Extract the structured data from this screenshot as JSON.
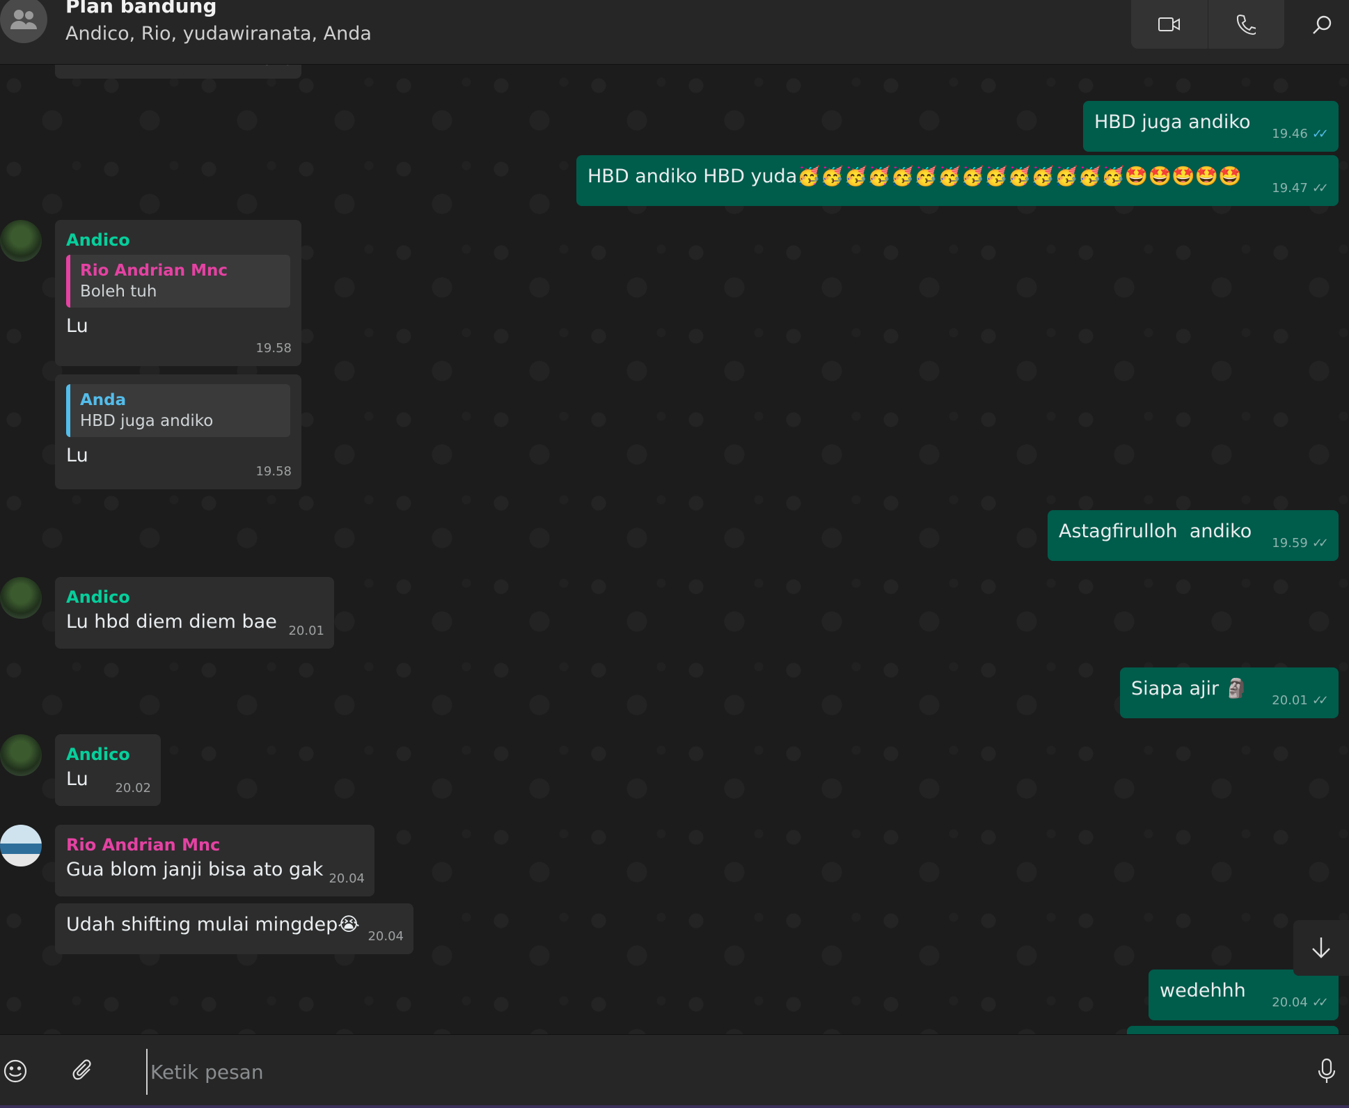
{
  "header": {
    "title": "Plan bandung",
    "members": "Andico, Rio, yudawiranata, Anda"
  },
  "messages": {
    "m0": {
      "time": "19.46"
    },
    "m1": {
      "text": "HBD juga andiko",
      "time": "19.46"
    },
    "m2": {
      "text": "HBD andiko HBD yuda🥳🥳🥳🥳🥳🥳🥳🥳🥳🥳🥳🥳🥳🥳🤩🤩🤩🤩🤩",
      "time": "19.47"
    },
    "m3": {
      "sender": "Andico",
      "quote_sender": "Rio Andrian Mnc",
      "quote_text": "Boleh tuh",
      "text": "Lu",
      "time": "19.58"
    },
    "m4": {
      "quote_sender": "Anda",
      "quote_text": "HBD juga andiko",
      "text": "Lu",
      "time": "19.58"
    },
    "m5": {
      "text": "Astagfirulloh  andiko",
      "time": "19.59"
    },
    "m6": {
      "sender": "Andico",
      "text": "Lu hbd diem diem bae",
      "time": "20.01"
    },
    "m7": {
      "text": "Siapa ajir 🗿",
      "time": "20.01"
    },
    "m8": {
      "sender": "Andico",
      "text": "Lu",
      "time": "20.02"
    },
    "m9": {
      "sender": "Rio Andrian Mnc",
      "text": "Gua blom janji bisa ato gak",
      "time": "20.04"
    },
    "m10": {
      "text": "Udah shifting mulai mingdep😭",
      "time": "20.04"
    },
    "m11": {
      "text": "wedehhh",
      "time": "20.04"
    }
  },
  "composer": {
    "placeholder": "Ketik pesan"
  },
  "icons": {
    "group": "group-avatar-icon",
    "video": "video-call-icon",
    "phone": "voice-call-icon",
    "search": "search-icon",
    "emoji": "emoji-icon",
    "attach": "attach-icon",
    "mic": "mic-icon",
    "scroll": "arrow-down-icon"
  },
  "colors": {
    "outgoing_bubble": "#005c4b",
    "incoming_bubble": "#2d2d2d",
    "andico_name": "#06cf9c",
    "rio_name": "#e542a3",
    "read_tick": "#53bdeb"
  }
}
